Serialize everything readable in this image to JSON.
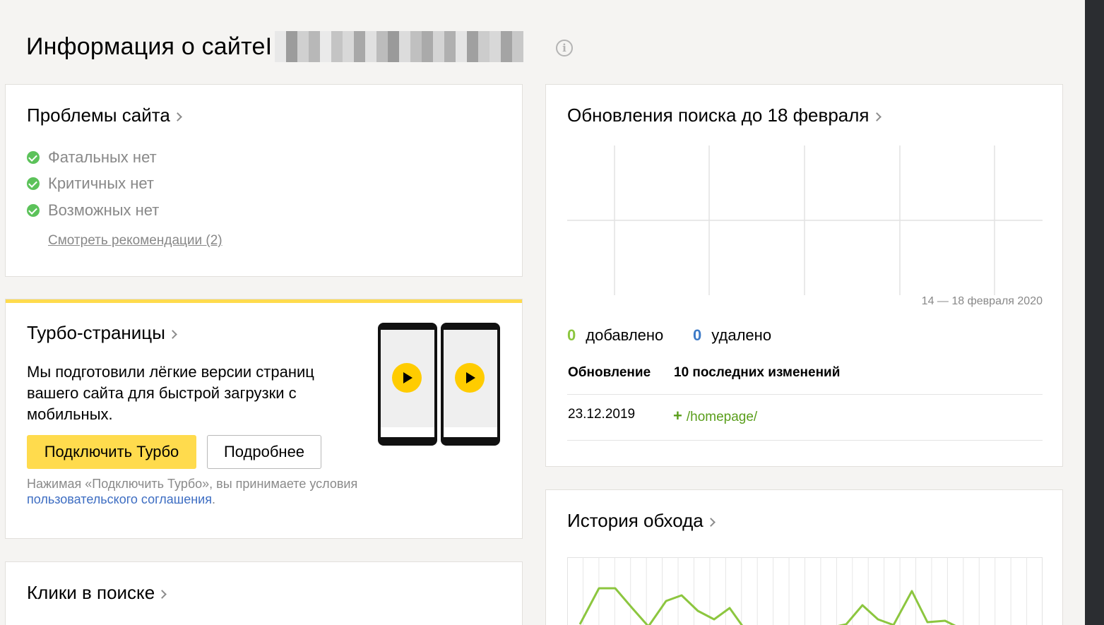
{
  "header": {
    "title": "Информация о сайте ",
    "title_cursor": "I"
  },
  "problems_card": {
    "title": "Проблемы сайта",
    "items": [
      "Фатальных нет",
      "Критичных нет",
      "Возможных нет"
    ],
    "link": "Смотреть рекомендации (2)"
  },
  "turbo_card": {
    "title": "Турбо-страницы",
    "description": "Мы подготовили лёгкие версии страниц вашего сайта для быстрой загрузки с мобильных.",
    "connect_button": "Подключить Турбо",
    "details_button": "Подробнее",
    "terms_prefix": "Нажимая «Подключить Турбо», вы принимаете условия",
    "terms_link": "пользовательского соглашения",
    "terms_suffix": "."
  },
  "clicks_card": {
    "title": "Клики в поиске"
  },
  "updates_card": {
    "title": "Обновления поиска до 18 февраля",
    "date_range": "14 — 18 февраля 2020",
    "added_count": "0",
    "added_label": "добавлено",
    "removed_count": "0",
    "removed_label": "удалено",
    "columns": [
      "Обновление",
      "10 последних изменений"
    ],
    "rows": [
      {
        "date": "23.12.2019",
        "change_sign": "+",
        "change": "/homepage/"
      }
    ]
  },
  "crawl_card": {
    "title": "История обхода"
  },
  "colors": {
    "accent_yellow": "#ffdb4d",
    "added_green": "#5cc25a",
    "removed_blue": "#3d7ac7",
    "line_green": "#8cc63f",
    "link_blue": "#3d6dc2"
  }
}
